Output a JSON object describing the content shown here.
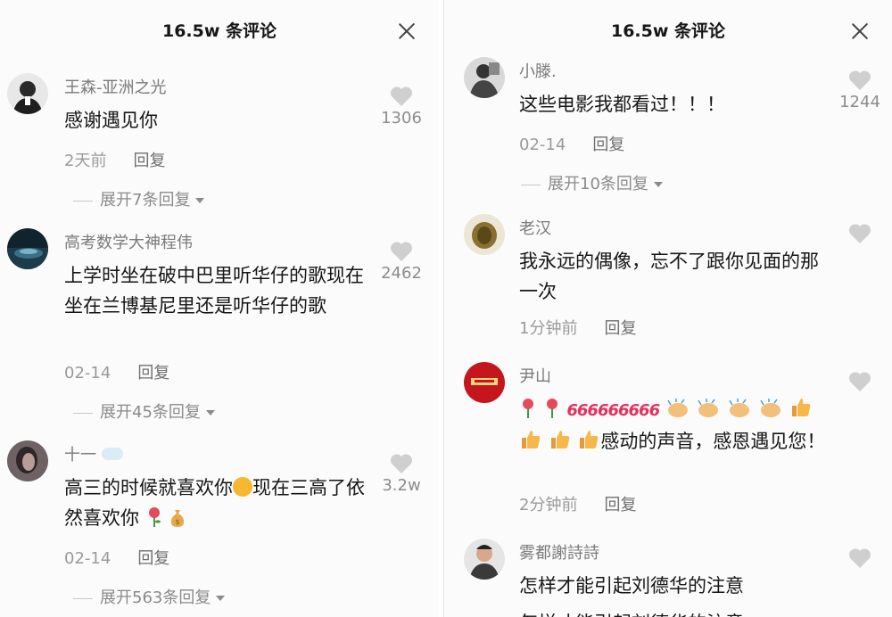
{
  "left_panel": {
    "header": {
      "title": "16.5w 条评论"
    },
    "comments": [
      {
        "username": "王森-亚洲之光",
        "text": "感谢遇见你",
        "time": "2天前",
        "reply_label": "回复",
        "likes": "1306",
        "expand_label": "展开7条回复"
      },
      {
        "username": "高考数学大神程伟",
        "text": "上学时坐在破中巴里听华仔的歌现在坐在兰博基尼里还是听华仔的歌",
        "time": "02-14",
        "reply_label": "回复",
        "likes": "2462",
        "expand_label": "展开45条回复"
      },
      {
        "username": "十一",
        "text_part1": "高三的时候就喜欢你",
        "text_part2": "现在三高了依然喜欢你",
        "time": "02-14",
        "reply_label": "回复",
        "likes": "3.2w",
        "expand_label": "展开563条回复"
      }
    ]
  },
  "right_panel": {
    "header": {
      "title": "16.5w 条评论"
    },
    "comments": [
      {
        "username": "小滕.",
        "text": "这些电影我都看过！！！",
        "time": "02-14",
        "reply_label": "回复",
        "likes": "1244",
        "expand_label": "展开10条回复"
      },
      {
        "username": "老汉",
        "text": "我永远的偶像，忘不了跟你见面的那一次",
        "time": "1分钟前",
        "reply_label": "回复"
      },
      {
        "username": "尹山",
        "emoji_text": "666",
        "text": "感动的声音，感恩遇见您！",
        "time": "2分钟前",
        "reply_label": "回复"
      },
      {
        "username": "雾都謝詩詩",
        "text": "怎样才能引起刘德华的注意",
        "text_cut": "怎样才能引起刘德华的注意"
      }
    ]
  },
  "colors": {
    "accent_red": "#e4325f",
    "meta_gray": "#9a9a9a",
    "name_gray": "#7a7a7a"
  },
  "icons": [
    "close-icon",
    "heart-icon",
    "smile-icon",
    "rose-icon",
    "money-bag-icon",
    "clap-icon",
    "thumbs-up-icon"
  ]
}
